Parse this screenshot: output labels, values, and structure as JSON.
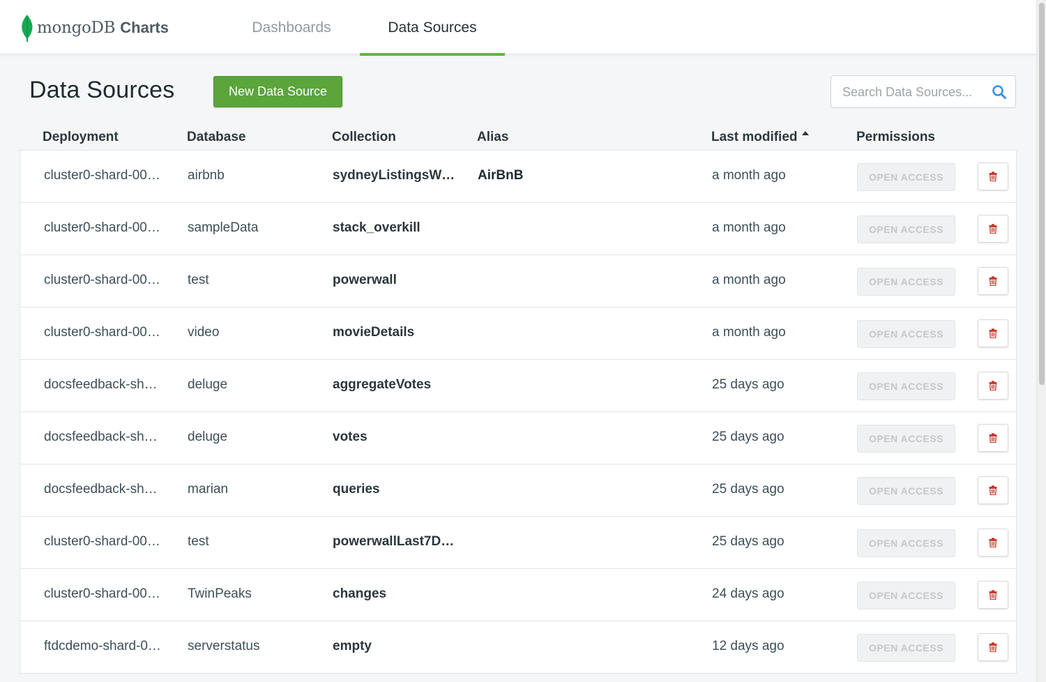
{
  "brand": {
    "mongo": "mongoDB",
    "charts": "Charts"
  },
  "nav": {
    "tabs": [
      {
        "label": "Dashboards"
      },
      {
        "label": "Data Sources"
      }
    ],
    "active": "Data Sources"
  },
  "page": {
    "title": "Data Sources",
    "new_button": "New Data Source"
  },
  "search": {
    "placeholder": "Search Data Sources...",
    "value": ""
  },
  "table": {
    "columns": {
      "deployment": "Deployment",
      "database": "Database",
      "collection": "Collection",
      "alias": "Alias",
      "last_modified": "Last modified",
      "permissions": "Permissions"
    },
    "sort": {
      "column": "Last modified",
      "direction": "ascending"
    },
    "rows": [
      {
        "deployment": "cluster0-shard-00…",
        "database": "airbnb",
        "collection": "sydneyListingsWi…",
        "alias": "AirBnB",
        "modified": "a month ago",
        "permission": "OPEN ACCESS"
      },
      {
        "deployment": "cluster0-shard-00…",
        "database": "sampleData",
        "collection": "stack_overkill",
        "alias": "",
        "modified": "a month ago",
        "permission": "OPEN ACCESS"
      },
      {
        "deployment": "cluster0-shard-00…",
        "database": "test",
        "collection": "powerwall",
        "alias": "",
        "modified": "a month ago",
        "permission": "OPEN ACCESS"
      },
      {
        "deployment": "cluster0-shard-00…",
        "database": "video",
        "collection": "movieDetails",
        "alias": "",
        "modified": "a month ago",
        "permission": "OPEN ACCESS"
      },
      {
        "deployment": "docsfeedback-sh…",
        "database": "deluge",
        "collection": "aggregateVotes",
        "alias": "",
        "modified": "25 days ago",
        "permission": "OPEN ACCESS"
      },
      {
        "deployment": "docsfeedback-sh…",
        "database": "deluge",
        "collection": "votes",
        "alias": "",
        "modified": "25 days ago",
        "permission": "OPEN ACCESS"
      },
      {
        "deployment": "docsfeedback-sh…",
        "database": "marian",
        "collection": "queries",
        "alias": "",
        "modified": "25 days ago",
        "permission": "OPEN ACCESS"
      },
      {
        "deployment": "cluster0-shard-00…",
        "database": "test",
        "collection": "powerwallLast7D…",
        "alias": "",
        "modified": "25 days ago",
        "permission": "OPEN ACCESS"
      },
      {
        "deployment": "cluster0-shard-00…",
        "database": "TwinPeaks",
        "collection": "changes",
        "alias": "",
        "modified": "24 days ago",
        "permission": "OPEN ACCESS"
      },
      {
        "deployment": "ftdcdemo-shard-0…",
        "database": "serverstatus",
        "collection": "empty",
        "alias": "",
        "modified": "12 days ago",
        "permission": "OPEN ACCESS"
      }
    ]
  },
  "colors": {
    "brand_green": "#5ba53b",
    "tab_underline": "#6ab04c",
    "delete_red": "#c0392b",
    "search_icon": "#3b8ee6"
  },
  "icons": {
    "leaf": "mongodb-leaf-icon",
    "search": "search-icon",
    "delete": "trash-icon",
    "sort": "sort-ascending-icon"
  }
}
